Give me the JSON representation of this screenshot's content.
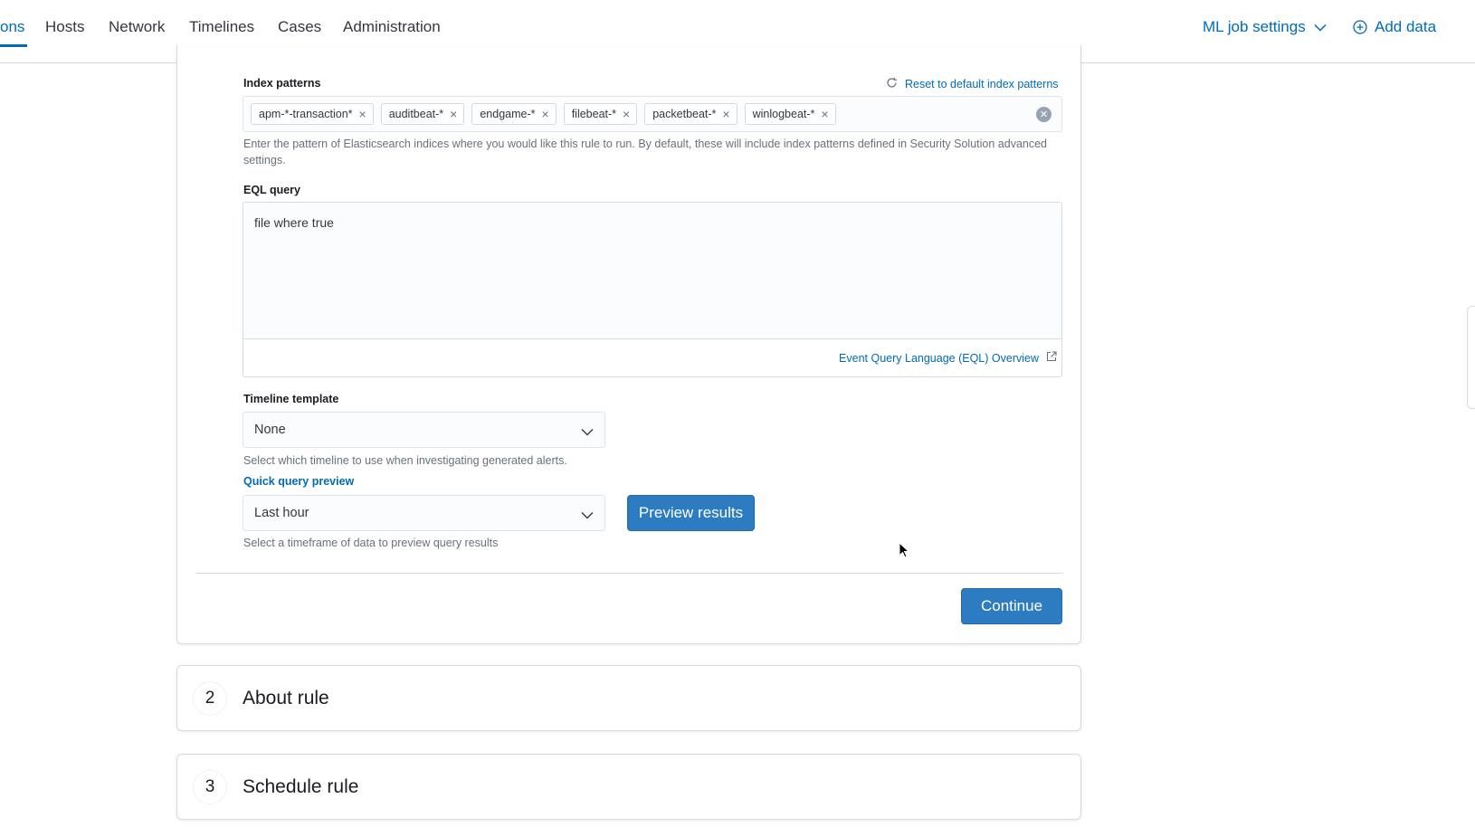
{
  "nav": {
    "tabs": [
      {
        "label": "ons",
        "active": true
      },
      {
        "label": "Hosts",
        "active": false
      },
      {
        "label": "Network",
        "active": false
      },
      {
        "label": "Timelines",
        "active": false
      },
      {
        "label": "Cases",
        "active": false
      },
      {
        "label": "Administration",
        "active": false
      }
    ],
    "ml_settings_label": "ML job settings",
    "add_data_label": "Add data"
  },
  "define_rule": {
    "index_patterns": {
      "label": "Index patterns",
      "reset_label": "Reset to default index patterns",
      "patterns": [
        "apm-*-transaction*",
        "auditbeat-*",
        "endgame-*",
        "filebeat-*",
        "packetbeat-*",
        "winlogbeat-*"
      ],
      "help_line1": "Enter the pattern of Elasticsearch indices where you would like this rule to run. By default, these will include index patterns defined in Security Solution advanced",
      "help_line2": "settings."
    },
    "eql_query": {
      "label": "EQL query",
      "value": "file where true",
      "overview_link": "Event Query Language (EQL) Overview"
    },
    "timeline_template": {
      "label": "Timeline template",
      "value": "None",
      "help": "Select which timeline to use when investigating generated alerts."
    },
    "quick_query_preview": {
      "label": "Quick query preview",
      "value": "Last hour",
      "help": "Select a timeframe of data to preview query results",
      "preview_button": "Preview results"
    },
    "continue_button": "Continue"
  },
  "steps": [
    {
      "number": "2",
      "title": "About rule"
    },
    {
      "number": "3",
      "title": "Schedule rule"
    }
  ],
  "colors": {
    "accent": "#006bb8",
    "button": "#2d7bc0",
    "border": "#d3dae6",
    "subdued_text": "#69707d"
  },
  "icons": [
    "chevron-down-icon",
    "plus-circle-icon",
    "refresh-icon",
    "clear-icon",
    "external-link-icon",
    "mouse-cursor-icon"
  ]
}
